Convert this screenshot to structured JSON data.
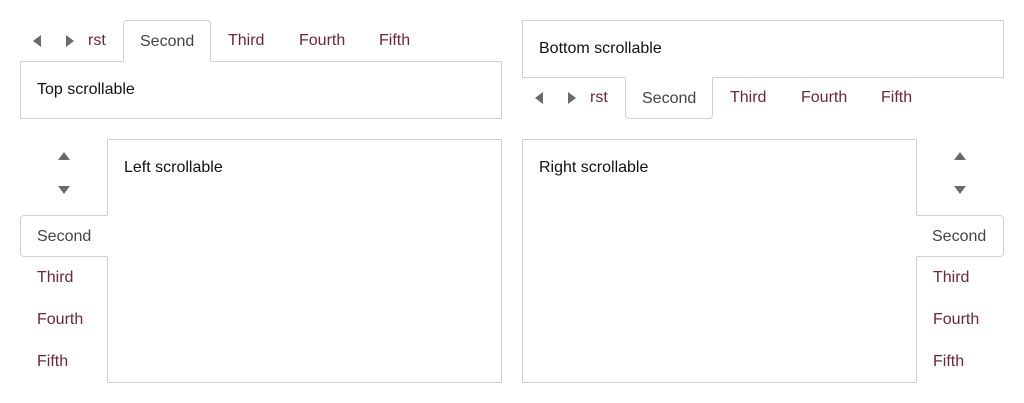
{
  "top_tabs": {
    "scroll_left_icon": "caret-left-icon",
    "scroll_right_icon": "caret-right-icon",
    "items": [
      "rst",
      "Second",
      "Third",
      "Fourth",
      "Fifth"
    ],
    "active": "Second",
    "panel_text": "Top scrollable"
  },
  "bottom_tabs": {
    "scroll_left_icon": "caret-left-icon",
    "scroll_right_icon": "caret-right-icon",
    "items": [
      "rst",
      "Second",
      "Third",
      "Fourth",
      "Fifth"
    ],
    "active": "Second",
    "panel_text": "Bottom scrollable"
  },
  "left_tabs": {
    "scroll_up_icon": "caret-up-icon",
    "scroll_down_icon": "caret-down-icon",
    "items": [
      "Second",
      "Third",
      "Fourth",
      "Fifth"
    ],
    "active": "Second",
    "panel_text": "Left scrollable"
  },
  "right_tabs": {
    "scroll_up_icon": "caret-up-icon",
    "scroll_down_icon": "caret-down-icon",
    "items": [
      "Second",
      "Third",
      "Fourth",
      "Fifth"
    ],
    "active": "Second",
    "panel_text": "Right scrollable"
  },
  "colors": {
    "tab_link": "#6b2737",
    "tab_active_text": "#444444",
    "border": "#d0d0d0",
    "arrow": "#6a6a6a"
  }
}
